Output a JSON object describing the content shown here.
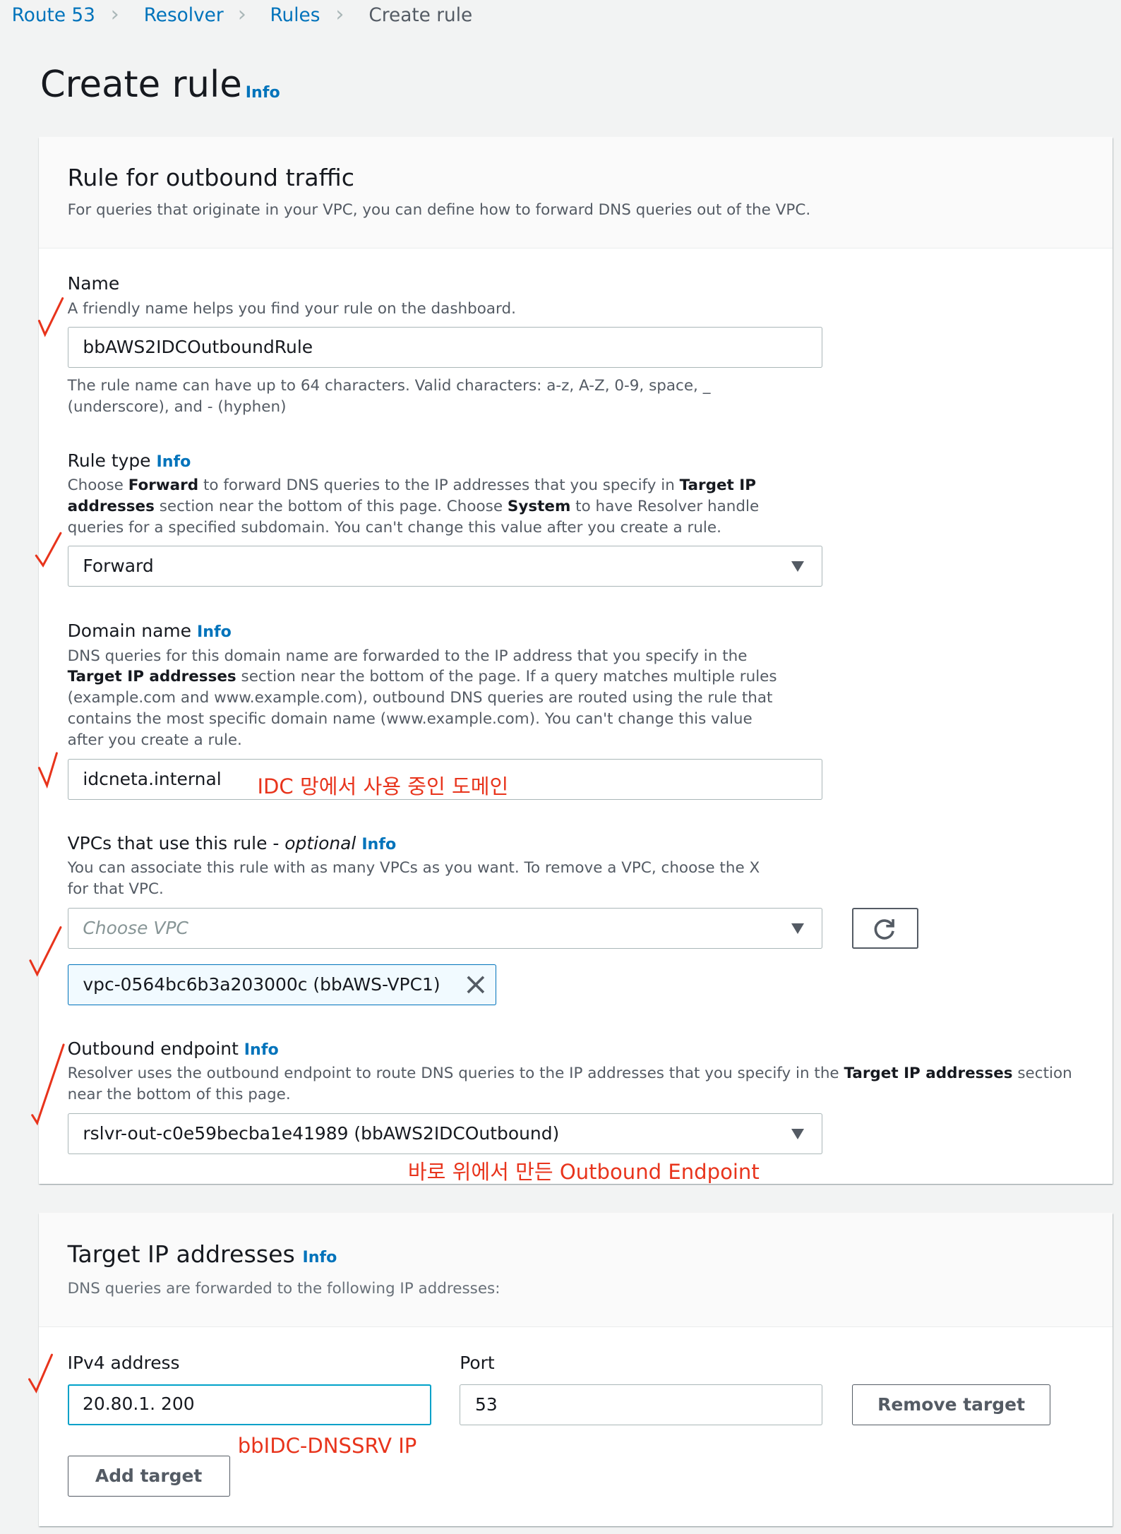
{
  "breadcrumb": [
    "Route 53",
    "Resolver",
    "Rules",
    "Create rule"
  ],
  "page": {
    "title": "Create rule",
    "info": "Info"
  },
  "outbound": {
    "title": "Rule for outbound traffic",
    "description": "For queries that originate in your VPC, you can define how to forward DNS queries out of the VPC.",
    "name": {
      "label": "Name",
      "help": "A friendly name helps you find your rule on the dashboard.",
      "value": "bbAWS2IDCOutboundRule",
      "hint": "The rule name can have up to 64 characters. Valid characters: a-z, A-Z, 0-9, space, _ (underscore), and - (hyphen)"
    },
    "rule_type": {
      "label": "Rule type",
      "info": "Info",
      "desc_1": "Choose ",
      "desc_b1": "Forward",
      "desc_2": " to forward DNS queries to the IP addresses that you specify in ",
      "desc_b2": "Target IP addresses",
      "desc_3": " section near the bottom of this page. Choose ",
      "desc_b3": "System",
      "desc_4": " to have Resolver handle queries for a specified subdomain. You can't change this value after you create a rule.",
      "value": "Forward"
    },
    "domain": {
      "label": "Domain name",
      "info": "Info",
      "desc_1": "DNS queries for this domain name are forwarded to the IP address that you specify in the ",
      "desc_b1": "Target IP addresses",
      "desc_2": " section near the bottom of the page. If a query matches multiple rules (example.com and www.example.com), outbound DNS queries are routed using the rule that contains the most specific domain name (www.example.com). You can't change this value after you create a rule.",
      "value": "idcneta.internal",
      "annotation": "IDC 망에서 사용 중인 도메인"
    },
    "vpcs": {
      "label": "VPCs that use this rule - ",
      "optional": "optional",
      "info": "Info",
      "desc": "You can associate this rule with as many VPCs as you want. To remove a VPC, choose the X for that VPC.",
      "placeholder": "Choose VPC",
      "token": "vpc-0564bc6b3a203000c (bbAWS-VPC1)"
    },
    "endpoint": {
      "label": "Outbound endpoint",
      "info": "Info",
      "desc_1": "Resolver uses the outbound endpoint to route DNS queries to the IP addresses that you specify in the ",
      "desc_b1": "Target IP addresses",
      "desc_2": " section near the bottom of this page.",
      "value": "rslvr-out-c0e59becba1e41989 (bbAWS2IDCOutbound)",
      "annotation": "바로 위에서 만든 Outbound Endpoint"
    }
  },
  "targets": {
    "title": "Target IP addresses",
    "info": "Info",
    "description": "DNS queries are forwarded to the following IP addresses:",
    "ipv4_label": "IPv4 address",
    "ipv4_value": "20.80.1. 200",
    "port_label": "Port",
    "port_value": "53",
    "remove_label": "Remove target",
    "add_label": "Add target",
    "annotation": "bbIDC-DNSSRV IP"
  },
  "colors": {
    "link": "#0073bb",
    "annotation": "#e8341c",
    "focus": "#00a1c9"
  }
}
